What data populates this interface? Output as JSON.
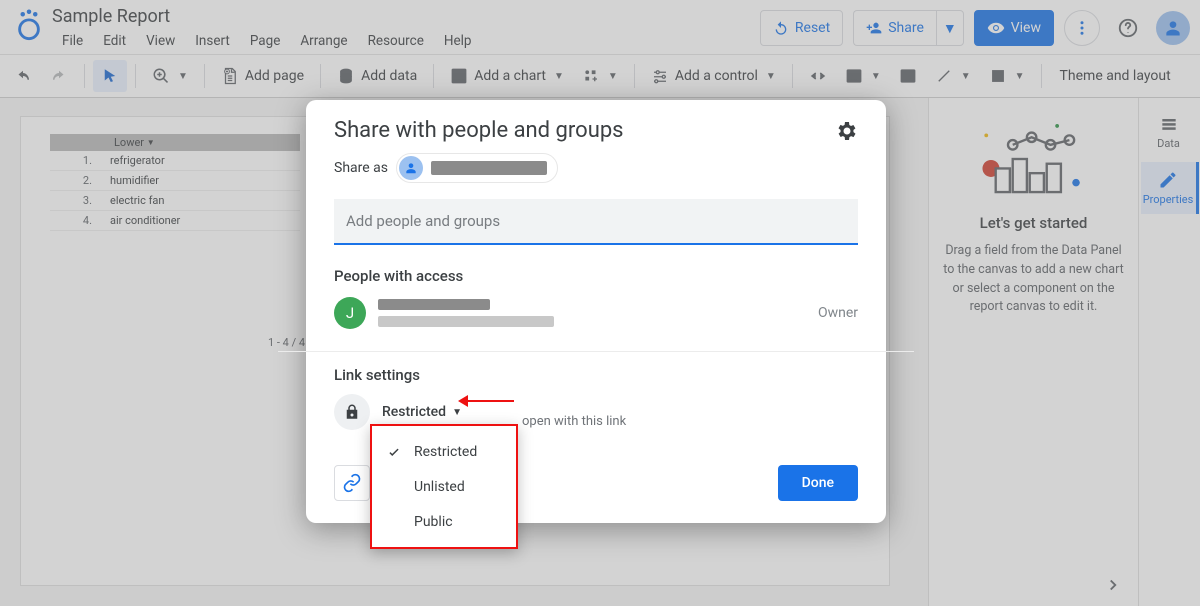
{
  "app": {
    "title": "Sample Report"
  },
  "menu": {
    "file": "File",
    "edit": "Edit",
    "view": "View",
    "insert": "Insert",
    "page": "Page",
    "arrange": "Arrange",
    "resource": "Resource",
    "help": "Help"
  },
  "header": {
    "reset": "Reset",
    "share": "Share",
    "view": "View"
  },
  "toolbar": {
    "add_page": "Add page",
    "add_data": "Add data",
    "add_chart": "Add a chart",
    "add_control": "Add a control",
    "theme": "Theme and layout"
  },
  "table": {
    "header": "Lower",
    "rows": [
      {
        "n": "1.",
        "v": "refrigerator"
      },
      {
        "n": "2.",
        "v": "humidifier"
      },
      {
        "n": "3.",
        "v": "electric fan"
      },
      {
        "n": "4.",
        "v": "air conditioner"
      }
    ],
    "pager": "1 - 4 / 4"
  },
  "right": {
    "title": "Let's get started",
    "text": "Drag a field from the Data Panel to the canvas to add a new chart or select a component on the report canvas to edit it."
  },
  "rail": {
    "data": "Data",
    "properties": "Properties"
  },
  "dialog": {
    "title": "Share with people and groups",
    "share_as": "Share as",
    "add_placeholder": "Add people and groups",
    "people_with_access": "People with access",
    "owner_avatar": "J",
    "owner_role": "Owner",
    "link_settings": "Link settings",
    "restricted": "Restricted",
    "link_hint": "open with this link",
    "done": "Done"
  },
  "dropdown": {
    "restricted": "Restricted",
    "unlisted": "Unlisted",
    "public": "Public"
  }
}
